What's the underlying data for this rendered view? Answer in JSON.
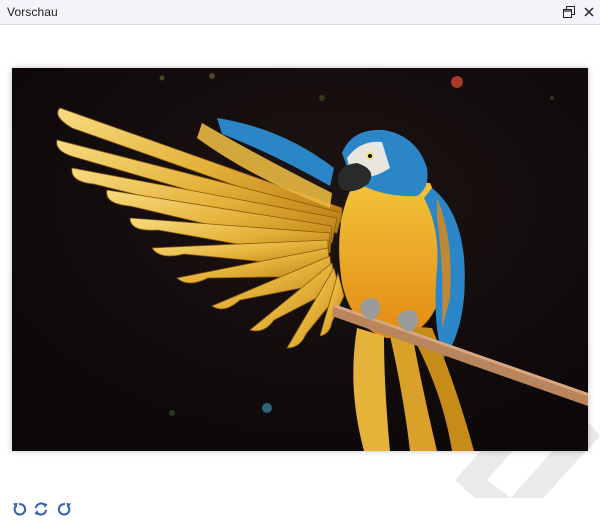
{
  "window": {
    "title": "Vorschau"
  },
  "titlebar": {
    "restore_icon": "restore-window-icon",
    "close_icon": "close-icon"
  },
  "preview": {
    "image_subject": "macaw-parrot-photo",
    "watermark_icon": "app-logo-watermark"
  },
  "toolbar": {
    "buttons": [
      {
        "icon": "rotate-left-icon"
      },
      {
        "icon": "rotate-both-icon"
      },
      {
        "icon": "rotate-right-icon"
      }
    ]
  },
  "colors": {
    "accent": "#2f5fae",
    "titlebar_bg": "#f3f5f8",
    "photo_bg": "#120a0c",
    "feather_gold": "#e7b53a",
    "feather_blue": "#2b86c7",
    "perch": "#b9855c"
  }
}
